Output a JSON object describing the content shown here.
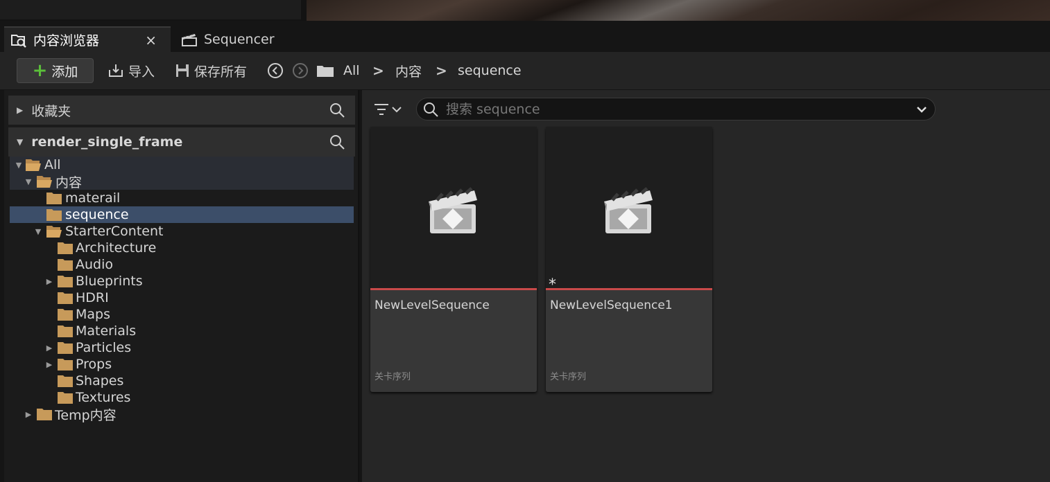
{
  "tabs": [
    {
      "label": "内容浏览器",
      "icon": "content-browser-icon",
      "close": "×"
    },
    {
      "label": "Sequencer",
      "icon": "clapperboard-icon"
    }
  ],
  "toolbar": {
    "add_label": "添加",
    "import_label": "导入",
    "save_all_label": "保存所有"
  },
  "breadcrumb": {
    "items": [
      "All",
      "内容",
      "sequence"
    ],
    "separator": ">"
  },
  "favorites": {
    "label": "收藏夹"
  },
  "project": {
    "label": "render_single_frame"
  },
  "tree": [
    {
      "label": "All",
      "expanded": true
    },
    {
      "label": "内容",
      "expanded": true
    },
    {
      "label": "materail"
    },
    {
      "label": "sequence",
      "selected": true
    },
    {
      "label": "StarterContent",
      "expanded": true
    },
    {
      "label": "Architecture"
    },
    {
      "label": "Audio"
    },
    {
      "label": "Blueprints",
      "collapsed": true
    },
    {
      "label": "HDRI"
    },
    {
      "label": "Maps"
    },
    {
      "label": "Materials"
    },
    {
      "label": "Particles",
      "collapsed": true
    },
    {
      "label": "Props",
      "collapsed": true
    },
    {
      "label": "Shapes"
    },
    {
      "label": "Textures"
    },
    {
      "label": "Temp内容",
      "collapsed": true
    }
  ],
  "search": {
    "placeholder": "搜索 sequence"
  },
  "assets": [
    {
      "name": "NewLevelSequence",
      "type": "关卡序列",
      "modified": false
    },
    {
      "name": "NewLevelSequence1",
      "type": "关卡序列",
      "modified": true,
      "modified_mark": "*"
    }
  ],
  "colors": {
    "selection": "#3c4e69",
    "asset_accent": "#c94a4a",
    "add_plus": "#5bbf3a",
    "folder": "#c79a5a"
  }
}
